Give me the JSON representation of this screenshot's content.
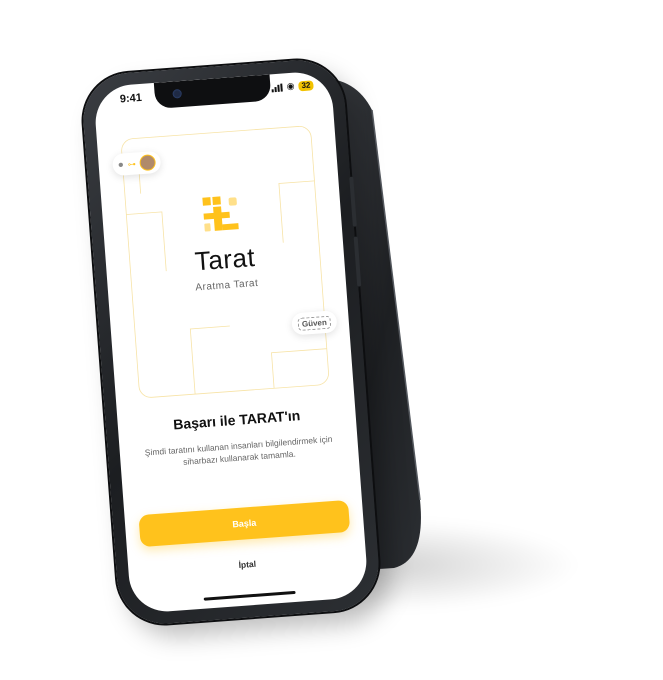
{
  "status_bar": {
    "time": "9:41",
    "battery": "32"
  },
  "illustration": {
    "chip_left_icon": "person-icon",
    "chip_right_word": "Güven"
  },
  "brand": {
    "logo_color": "#ffc21c",
    "name": "Tarat",
    "subtitle": "Aratma Tarat"
  },
  "onboarding": {
    "headline": "Başarı ile TARAT'ın",
    "description": "Şimdi taratını kullanan insanları bilgilendirmek için siharbazı kullanarak tamamla.",
    "start_button": "Başla",
    "cancel_link": "İptal"
  },
  "colors": {
    "accent": "#ffc21c",
    "device": "#1c1e21"
  }
}
